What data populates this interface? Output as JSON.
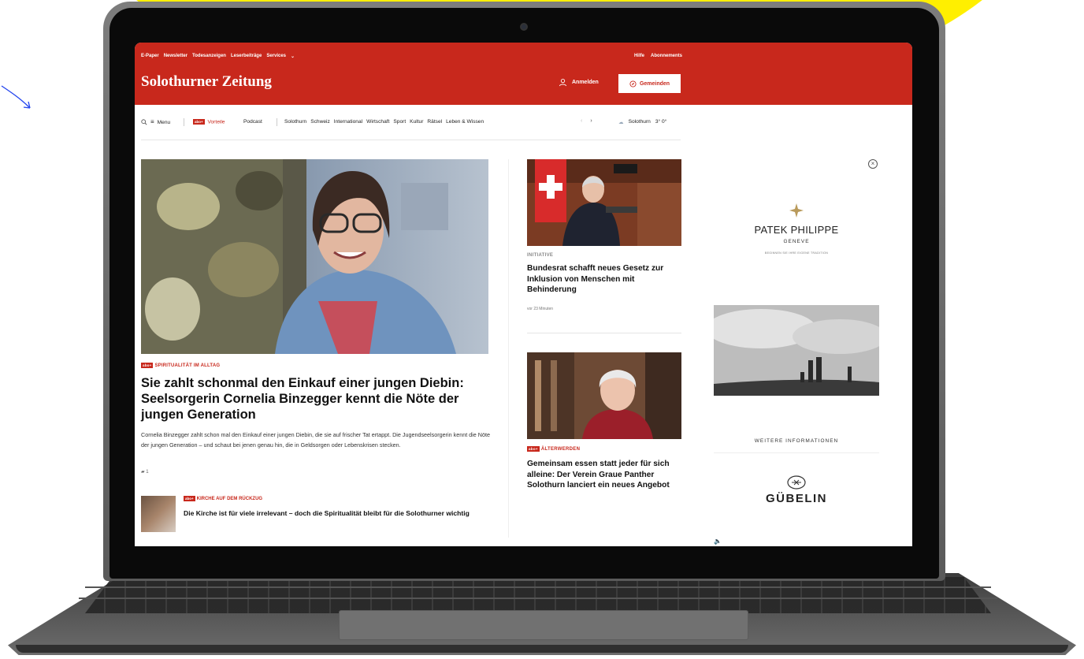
{
  "top_links": [
    "E-Paper",
    "Newsletter",
    "Todesanzeigen",
    "Leserbeiträge",
    "Services"
  ],
  "top_right_links": [
    "Hilfe",
    "Abonnements"
  ],
  "logo": "Solothurner Zeitung",
  "login_label": "Anmelden",
  "gemeinden_label": "Gemeinden",
  "nav": {
    "menu_label": "Menu",
    "abo_badge": "abo+",
    "vorteile": "Vorteile",
    "podcast": "Podcast",
    "sections": [
      "Solothurn",
      "Schweiz",
      "International",
      "Wirtschaft",
      "Sport",
      "Kultur",
      "Rätsel",
      "Leben & Wissen"
    ],
    "weather_location": "Solothurn",
    "weather_temp": "3° 0°"
  },
  "main_article": {
    "badge": "abo+",
    "kicker": "SPIRITUALITÄT IM ALLTAG",
    "headline": "Sie zahlt schonmal den Einkauf einer jungen Diebin: Seelsorgerin Cornelia Binzegger kennt die Nöte der jungen Generation",
    "lead": "Cornelia Binzegger zahlt schon mal den Einkauf einer jungen Diebin, die sie auf frischer Tat ertappt. Die Jugendseelsorgerin kennt die Nöte der jungen Generation – und schaut bei jenen genau hin, die in Geldsorgen oder Lebenskrisen stecken.",
    "comments": "1"
  },
  "small_article": {
    "badge": "abo+",
    "kicker": "KIRCHE AUF DEM RÜCKZUG",
    "headline": "Die Kirche ist für viele irrelevant – doch die Spiritualität bleibt für die Solothurner wichtig"
  },
  "mid_article_1": {
    "kicker": "INITIATIVE",
    "headline": "Bundesrat schafft neues Gesetz zur Inklusion von Menschen mit Behinderung",
    "time": "vor 23 Minuten"
  },
  "mid_article_2": {
    "badge": "abo+",
    "kicker": "ÄLTERWERDEN",
    "headline": "Gemeinsam essen statt jeder für sich alleine: Der Verein Graue Panther Solothurn lanciert ein neues Angebot"
  },
  "ad": {
    "brand": "PATEK PHILIPPE",
    "city": "GENEVE",
    "tagline": "BEGINNEN SIE IHRE EIGENE TRADITION",
    "info": "WEITERE INFORMATIONEN",
    "brand2": "GÜBELIN"
  },
  "colors": {
    "brand_red": "#c8281c",
    "background_yellow": "#ffef00"
  }
}
